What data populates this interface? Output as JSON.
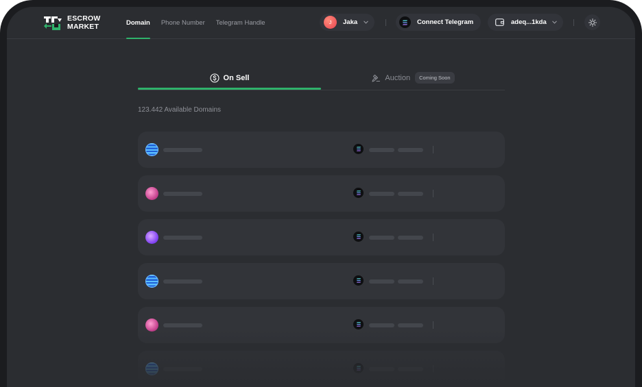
{
  "brand": {
    "line1": "ESCROW",
    "line2": "MARKET"
  },
  "nav": {
    "tabs": [
      {
        "label": "Domain",
        "active": true
      },
      {
        "label": "Phone Number",
        "active": false
      },
      {
        "label": "Telegram Handle",
        "active": false
      }
    ]
  },
  "user": {
    "initial": "J",
    "name": "Jaka"
  },
  "connect_telegram": {
    "label": "Connect Telegram"
  },
  "wallet": {
    "address": "adeq...1kda"
  },
  "market_tabs": {
    "on_sell": "On Sell",
    "auction": "Auction",
    "auction_badge": "Coming Soon"
  },
  "available_text": "123.442 Available Domains",
  "rows": [
    {
      "icon": "globe-blue-icon"
    },
    {
      "icon": "globe-pink-icon"
    },
    {
      "icon": "globe-purple-icon"
    },
    {
      "icon": "globe-blue-icon"
    },
    {
      "icon": "globe-pink-icon"
    },
    {
      "icon": "globe-blue-icon"
    }
  ],
  "colors": {
    "accent": "#2fb36b",
    "background": "#2b2d31",
    "card": "#323439"
  }
}
